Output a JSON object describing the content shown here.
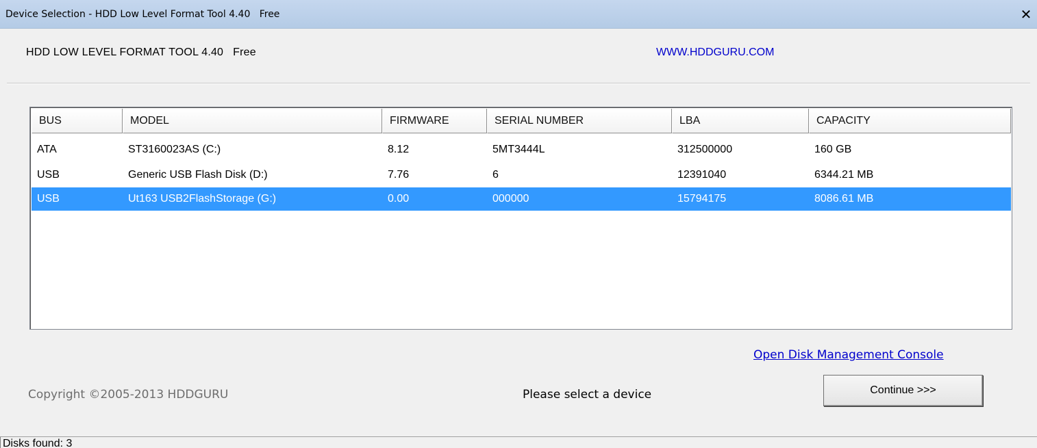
{
  "window": {
    "title": "Device Selection - HDD Low Level Format Tool 4.40   Free",
    "close_glyph": "✕"
  },
  "header": {
    "product": "HDD LOW LEVEL FORMAT TOOL 4.40   Free",
    "website": "WWW.HDDGURU.COM"
  },
  "device_list": {
    "columns": [
      "BUS",
      "MODEL",
      "FIRMWARE",
      "SERIAL NUMBER",
      "LBA",
      "CAPACITY"
    ],
    "rows": [
      {
        "bus": "ATA",
        "model": "ST3160023AS (C:)",
        "firmware": "8.12",
        "serial": "5MT3444L",
        "lba": "312500000",
        "capacity": "160 GB",
        "selected": false
      },
      {
        "bus": "USB",
        "model": "Generic USB Flash Disk (D:)",
        "firmware": "7.76",
        "serial": "6",
        "lba": "12391040",
        "capacity": "6344.21 MB",
        "selected": false
      },
      {
        "bus": "USB",
        "model": "Ut163 USB2FlashStorage (G:)",
        "firmware": "0.00",
        "serial": "000000",
        "lba": "15794175",
        "capacity": "8086.61 MB",
        "selected": true
      }
    ],
    "selection_color": "#3399ff"
  },
  "footer": {
    "disk_mgmt_link": "Open Disk Management Console",
    "copyright": "Copyright ©2005-2013 HDDGURU",
    "status_message": "Please select a device",
    "continue_label": "Continue >>>"
  },
  "statusbar": {
    "text": "Disks found: 3"
  }
}
